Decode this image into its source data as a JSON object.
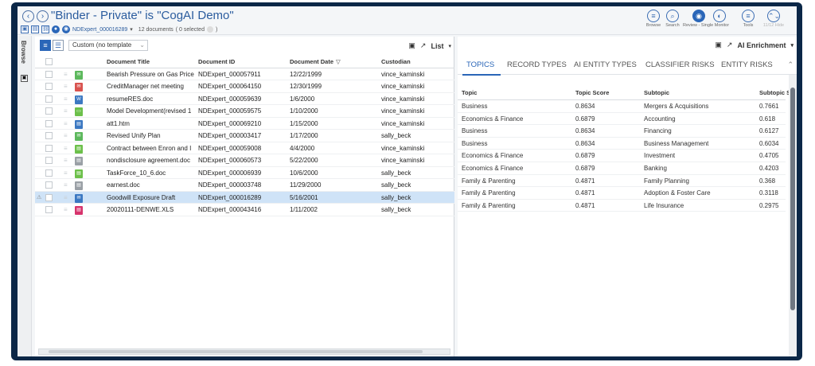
{
  "header": {
    "title": "\"Binder - Private\" is \"CogAI Demo\"",
    "doc_id": "NDExpert_000016289",
    "doc_count": "12 documents",
    "selected": "( 0 selected",
    "close_paren": ")",
    "toolbar": [
      {
        "label": "Browse",
        "icon": "list-icon",
        "glyph": "≡",
        "filled": false,
        "disabled": false
      },
      {
        "label": "Search",
        "icon": "search-icon",
        "glyph": "⌕",
        "filled": false,
        "disabled": false
      },
      {
        "label": "Review - Single Monitor",
        "icon": "review-icon",
        "glyph": "◉",
        "filled": true,
        "disabled": false
      },
      {
        "label": "",
        "icon": "review-split-icon",
        "glyph": "◐",
        "filled": false,
        "disabled": false
      },
      {
        "label": "Tools",
        "icon": "tools-icon",
        "glyph": "≡",
        "filled": false,
        "disabled": false
      },
      {
        "label": "11/12 Hide",
        "icon": "nav-up-down-icon",
        "glyph": "⌃⌄",
        "filled": false,
        "disabled": true
      }
    ]
  },
  "browse": {
    "label": "Browse"
  },
  "left_pane": {
    "template": "Custom (no template",
    "view": "List",
    "columns": [
      "Document Title",
      "Document ID",
      "Document Date",
      "Custodian"
    ],
    "rows": [
      {
        "title": "Bearish Pressure on Gas Price",
        "id": "NDExpert_000057911",
        "date": "12/22/1999",
        "custodian": "vince_kaminski",
        "type": "email",
        "color": "#5cb85c",
        "glyph": "✉",
        "selected": false
      },
      {
        "title": "CreditManager net meeting",
        "id": "NDExpert_000064150",
        "date": "12/30/1999",
        "custodian": "vince_kaminski",
        "type": "email",
        "color": "#d9534f",
        "glyph": "✉",
        "selected": false
      },
      {
        "title": "resumeRES.doc",
        "id": "NDExpert_000059639",
        "date": "1/6/2000",
        "custodian": "vince_kaminski",
        "type": "word",
        "color": "#3b78c2",
        "glyph": "W",
        "selected": false
      },
      {
        "title": "Model Development(revised 1",
        "id": "NDExpert_000059575",
        "date": "1/10/2000",
        "custodian": "vince_kaminski",
        "type": "doc",
        "color": "#6cc04a",
        "glyph": "▭",
        "selected": false
      },
      {
        "title": "att1.htm",
        "id": "NDExpert_000069210",
        "date": "1/15/2000",
        "custodian": "vince_kaminski",
        "type": "html",
        "color": "#3b78c2",
        "glyph": "▤",
        "selected": false
      },
      {
        "title": "Revised Unify Plan",
        "id": "NDExpert_000003417",
        "date": "1/17/2000",
        "custodian": "sally_beck",
        "type": "email",
        "color": "#5cb85c",
        "glyph": "✉",
        "selected": false
      },
      {
        "title": "Contract between Enron and I",
        "id": "NDExpert_000059008",
        "date": "4/4/2000",
        "custodian": "vince_kaminski",
        "type": "doc",
        "color": "#6cc04a",
        "glyph": "▤",
        "selected": false
      },
      {
        "title": "nondisclosure agreement.doc",
        "id": "NDExpert_000060573",
        "date": "5/22/2000",
        "custodian": "vince_kaminski",
        "type": "doc",
        "color": "#9aa0a6",
        "glyph": "▤",
        "selected": false
      },
      {
        "title": "TaskForce_10_6.doc",
        "id": "NDExpert_000006939",
        "date": "10/6/2000",
        "custodian": "sally_beck",
        "type": "doc",
        "color": "#6cc04a",
        "glyph": "▤",
        "selected": false
      },
      {
        "title": "earnest.doc",
        "id": "NDExpert_000003748",
        "date": "11/29/2000",
        "custodian": "sally_beck",
        "type": "doc",
        "color": "#9aa0a6",
        "glyph": "▤",
        "selected": false
      },
      {
        "title": "Goodwill Exposure Draft",
        "id": "NDExpert_000016289",
        "date": "5/16/2001",
        "custodian": "sally_beck",
        "type": "email",
        "color": "#3b78c2",
        "glyph": "✉",
        "selected": true
      },
      {
        "title": "20020111-DENWE.XLS",
        "id": "NDExpert_000043416",
        "date": "1/11/2002",
        "custodian": "sally_beck",
        "type": "xls",
        "color": "#d6336c",
        "glyph": "▤",
        "selected": false
      }
    ]
  },
  "right_pane": {
    "panel_title": "AI Enrichment",
    "tabs": [
      "TOPICS",
      "RECORD TYPES",
      "AI ENTITY TYPES",
      "CLASSIFIER RISKS",
      "ENTITY RISKS"
    ],
    "active_tab": 0,
    "columns": [
      "Topic",
      "Topic Score",
      "Subtopic",
      "Subtopic Sc"
    ],
    "rows": [
      {
        "topic": "Business",
        "score": "0.8634",
        "subtopic": "Mergers & Acquisitions",
        "subscore": "0.7661"
      },
      {
        "topic": "Economics & Finance",
        "score": "0.6879",
        "subtopic": "Accounting",
        "subscore": "0.618"
      },
      {
        "topic": "Business",
        "score": "0.8634",
        "subtopic": "Financing",
        "subscore": "0.6127"
      },
      {
        "topic": "Business",
        "score": "0.8634",
        "subtopic": "Business Management",
        "subscore": "0.6034"
      },
      {
        "topic": "Economics & Finance",
        "score": "0.6879",
        "subtopic": "Investment",
        "subscore": "0.4705"
      },
      {
        "topic": "Economics & Finance",
        "score": "0.6879",
        "subtopic": "Banking",
        "subscore": "0.4203"
      },
      {
        "topic": "Family & Parenting",
        "score": "0.4871",
        "subtopic": "Family Planning",
        "subscore": "0.368"
      },
      {
        "topic": "Family & Parenting",
        "score": "0.4871",
        "subtopic": "Adoption & Foster Care",
        "subscore": "0.3118"
      },
      {
        "topic": "Family & Parenting",
        "score": "0.4871",
        "subtopic": "Life Insurance",
        "subscore": "0.2975"
      }
    ]
  }
}
